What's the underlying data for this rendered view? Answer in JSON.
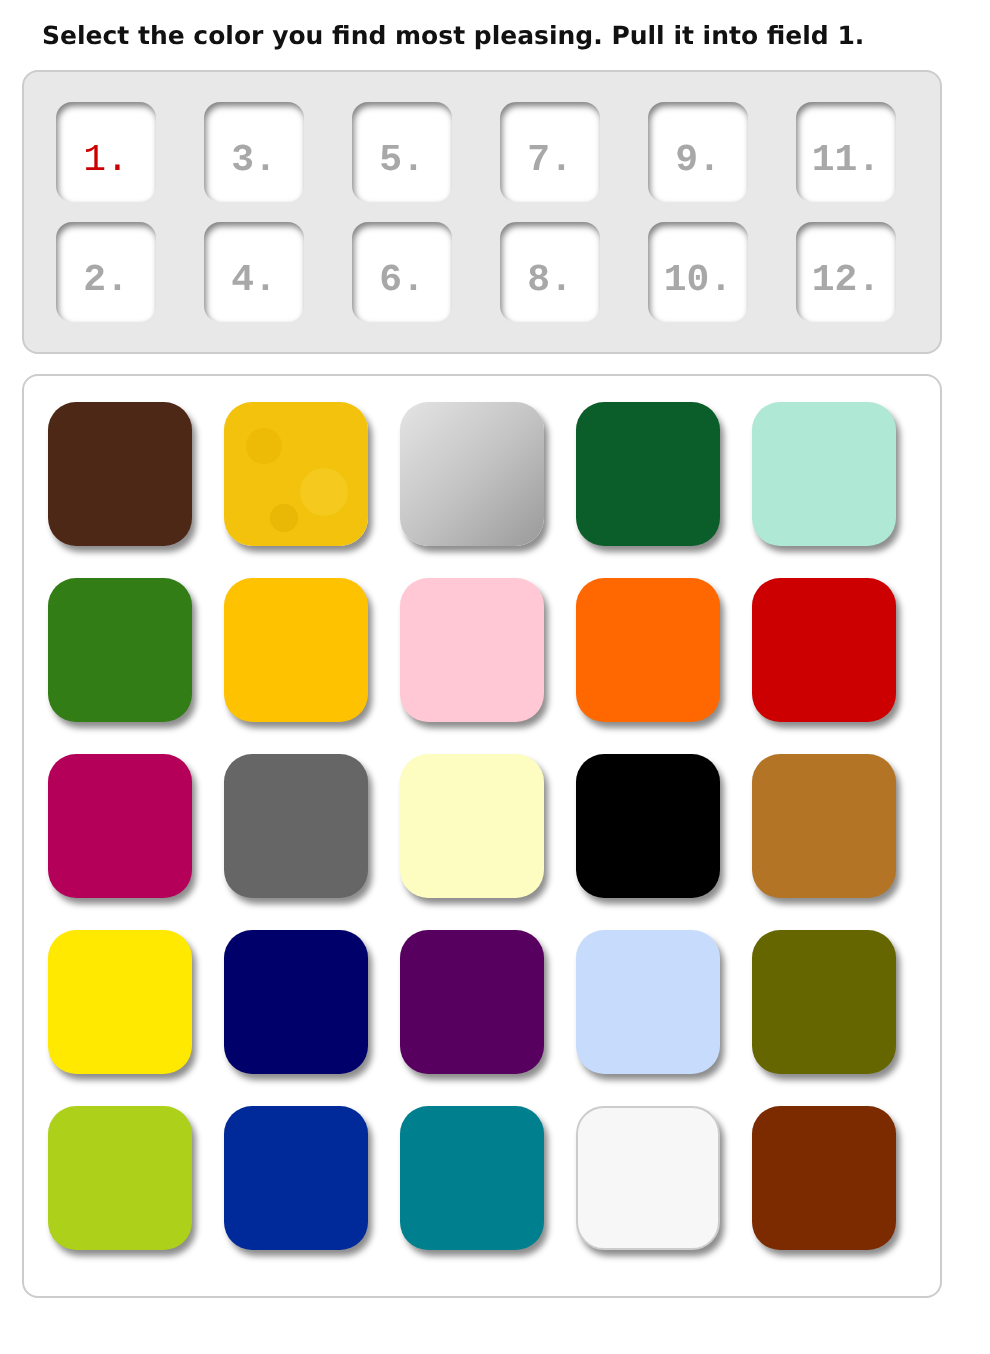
{
  "instruction": "Select the color you find most pleasing. Pull it into field 1.",
  "slots": [
    {
      "label": "1.",
      "selected": true
    },
    {
      "label": "3.",
      "selected": false
    },
    {
      "label": "5.",
      "selected": false
    },
    {
      "label": "7.",
      "selected": false
    },
    {
      "label": "9.",
      "selected": false
    },
    {
      "label": "11.",
      "selected": false
    },
    {
      "label": "2.",
      "selected": false
    },
    {
      "label": "4.",
      "selected": false
    },
    {
      "label": "6.",
      "selected": false
    },
    {
      "label": "8.",
      "selected": false
    },
    {
      "label": "10.",
      "selected": false
    },
    {
      "label": "12.",
      "selected": false
    }
  ],
  "swatches": [
    {
      "kind": "solid",
      "color": "#4d2816"
    },
    {
      "kind": "gold",
      "color": "#f2c20c"
    },
    {
      "kind": "silver",
      "color": "#c4c4c4"
    },
    {
      "kind": "solid",
      "color": "#0b5e2a"
    },
    {
      "kind": "solid",
      "color": "#b0e8d6"
    },
    {
      "kind": "solid",
      "color": "#327d15"
    },
    {
      "kind": "solid",
      "color": "#fec200"
    },
    {
      "kind": "solid",
      "color": "#ffc8d4"
    },
    {
      "kind": "solid",
      "color": "#ff6700"
    },
    {
      "kind": "solid",
      "color": "#cc0000"
    },
    {
      "kind": "solid",
      "color": "#b5005a"
    },
    {
      "kind": "solid",
      "color": "#666666"
    },
    {
      "kind": "solid",
      "color": "#fdfdc2"
    },
    {
      "kind": "solid",
      "color": "#000000"
    },
    {
      "kind": "solid",
      "color": "#b47426"
    },
    {
      "kind": "solid",
      "color": "#ffe900"
    },
    {
      "kind": "solid",
      "color": "#00006b"
    },
    {
      "kind": "solid",
      "color": "#570060"
    },
    {
      "kind": "solid",
      "color": "#c7dcfc"
    },
    {
      "kind": "solid",
      "color": "#666600"
    },
    {
      "kind": "solid",
      "color": "#add11b"
    },
    {
      "kind": "solid",
      "color": "#002a9a"
    },
    {
      "kind": "solid",
      "color": "#00808f"
    },
    {
      "kind": "solid",
      "color": "#f7f7f7"
    },
    {
      "kind": "solid",
      "color": "#7c2a00"
    }
  ]
}
